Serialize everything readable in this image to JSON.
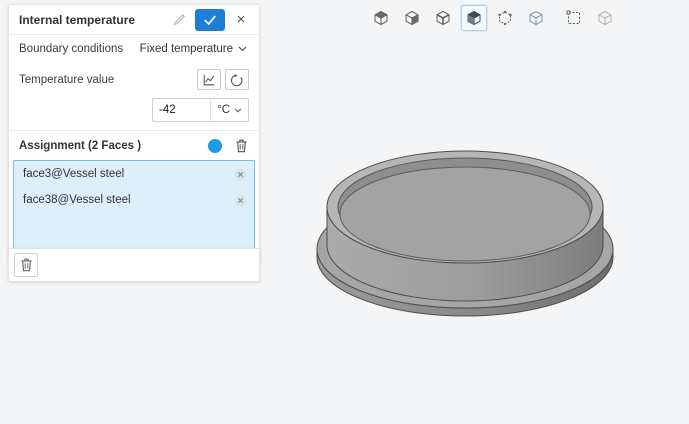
{
  "panel": {
    "title": "Internal temperature",
    "close_label": "×",
    "boundary_conditions": {
      "label": "Boundary conditions",
      "value": "Fixed temperature"
    },
    "temperature_value": {
      "label": "Temperature value",
      "value": "-42",
      "unit": "°C"
    },
    "assignment": {
      "label": "Assignment (2 Faces )",
      "items": [
        {
          "name": "face3@Vessel steel"
        },
        {
          "name": "face38@Vessel steel"
        }
      ]
    }
  },
  "toolbar": {
    "tools": [
      "select-volume",
      "select-face",
      "select-edge",
      "select-face-active",
      "select-vertex",
      "show-wireframe",
      "box-select",
      "more-view-options"
    ]
  },
  "colors": {
    "accent_blue": "#1c7ed6",
    "toggle_blue": "#1b9ce3",
    "selection_bg": "#dceffa",
    "selection_border": "#7abfe2",
    "model_gray": "#9c9c9c"
  }
}
